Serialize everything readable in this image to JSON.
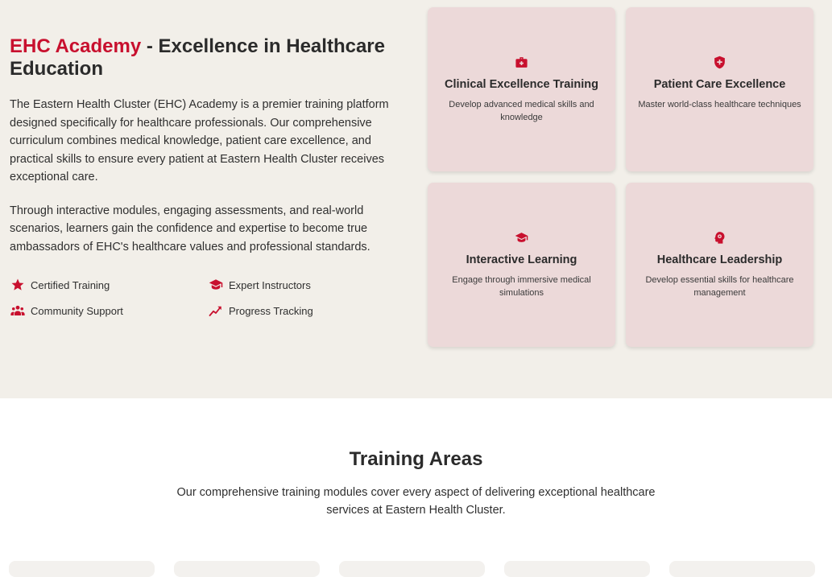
{
  "intro": {
    "title_accent": "EHC Academy",
    "title_rest": " - Excellence in Healthcare Education",
    "paragraph1": "The Eastern Health Cluster (EHC) Academy is a premier training platform designed specifically for healthcare professionals. Our comprehensive curriculum combines medical knowledge, patient care excellence, and practical skills to ensure every patient at Eastern Health Cluster receives exceptional care.",
    "paragraph2": "Through interactive modules, engaging assessments, and real-world scenarios, learners gain the confidence and expertise to become true ambassadors of EHC's healthcare values and professional standards."
  },
  "features": [
    {
      "label": "Certified Training",
      "icon": "star-icon"
    },
    {
      "label": "Expert Instructors",
      "icon": "graduation-cap-icon"
    },
    {
      "label": "Community Support",
      "icon": "users-icon"
    },
    {
      "label": "Progress Tracking",
      "icon": "chart-line-icon"
    }
  ],
  "cards": [
    {
      "title": "Clinical Excellence Training",
      "description": "Develop advanced medical skills and knowledge",
      "icon": "medical-kit-icon"
    },
    {
      "title": "Patient Care Excellence",
      "description": "Master world-class healthcare techniques",
      "icon": "shield-cross-icon"
    },
    {
      "title": "Interactive Learning",
      "description": "Engage through immersive medical simulations",
      "icon": "graduation-cap-icon"
    },
    {
      "title": "Healthcare Leadership",
      "description": "Develop essential skills for healthcare management",
      "icon": "head-gear-icon"
    }
  ],
  "training_areas": {
    "title": "Training Areas",
    "subtitle": "Our comprehensive training modules cover every aspect of delivering exceptional healthcare services at Eastern Health Cluster."
  },
  "colors": {
    "accent": "#c8102e",
    "hero_background": "#f2efe9",
    "card_background": "#ecd9d9"
  }
}
